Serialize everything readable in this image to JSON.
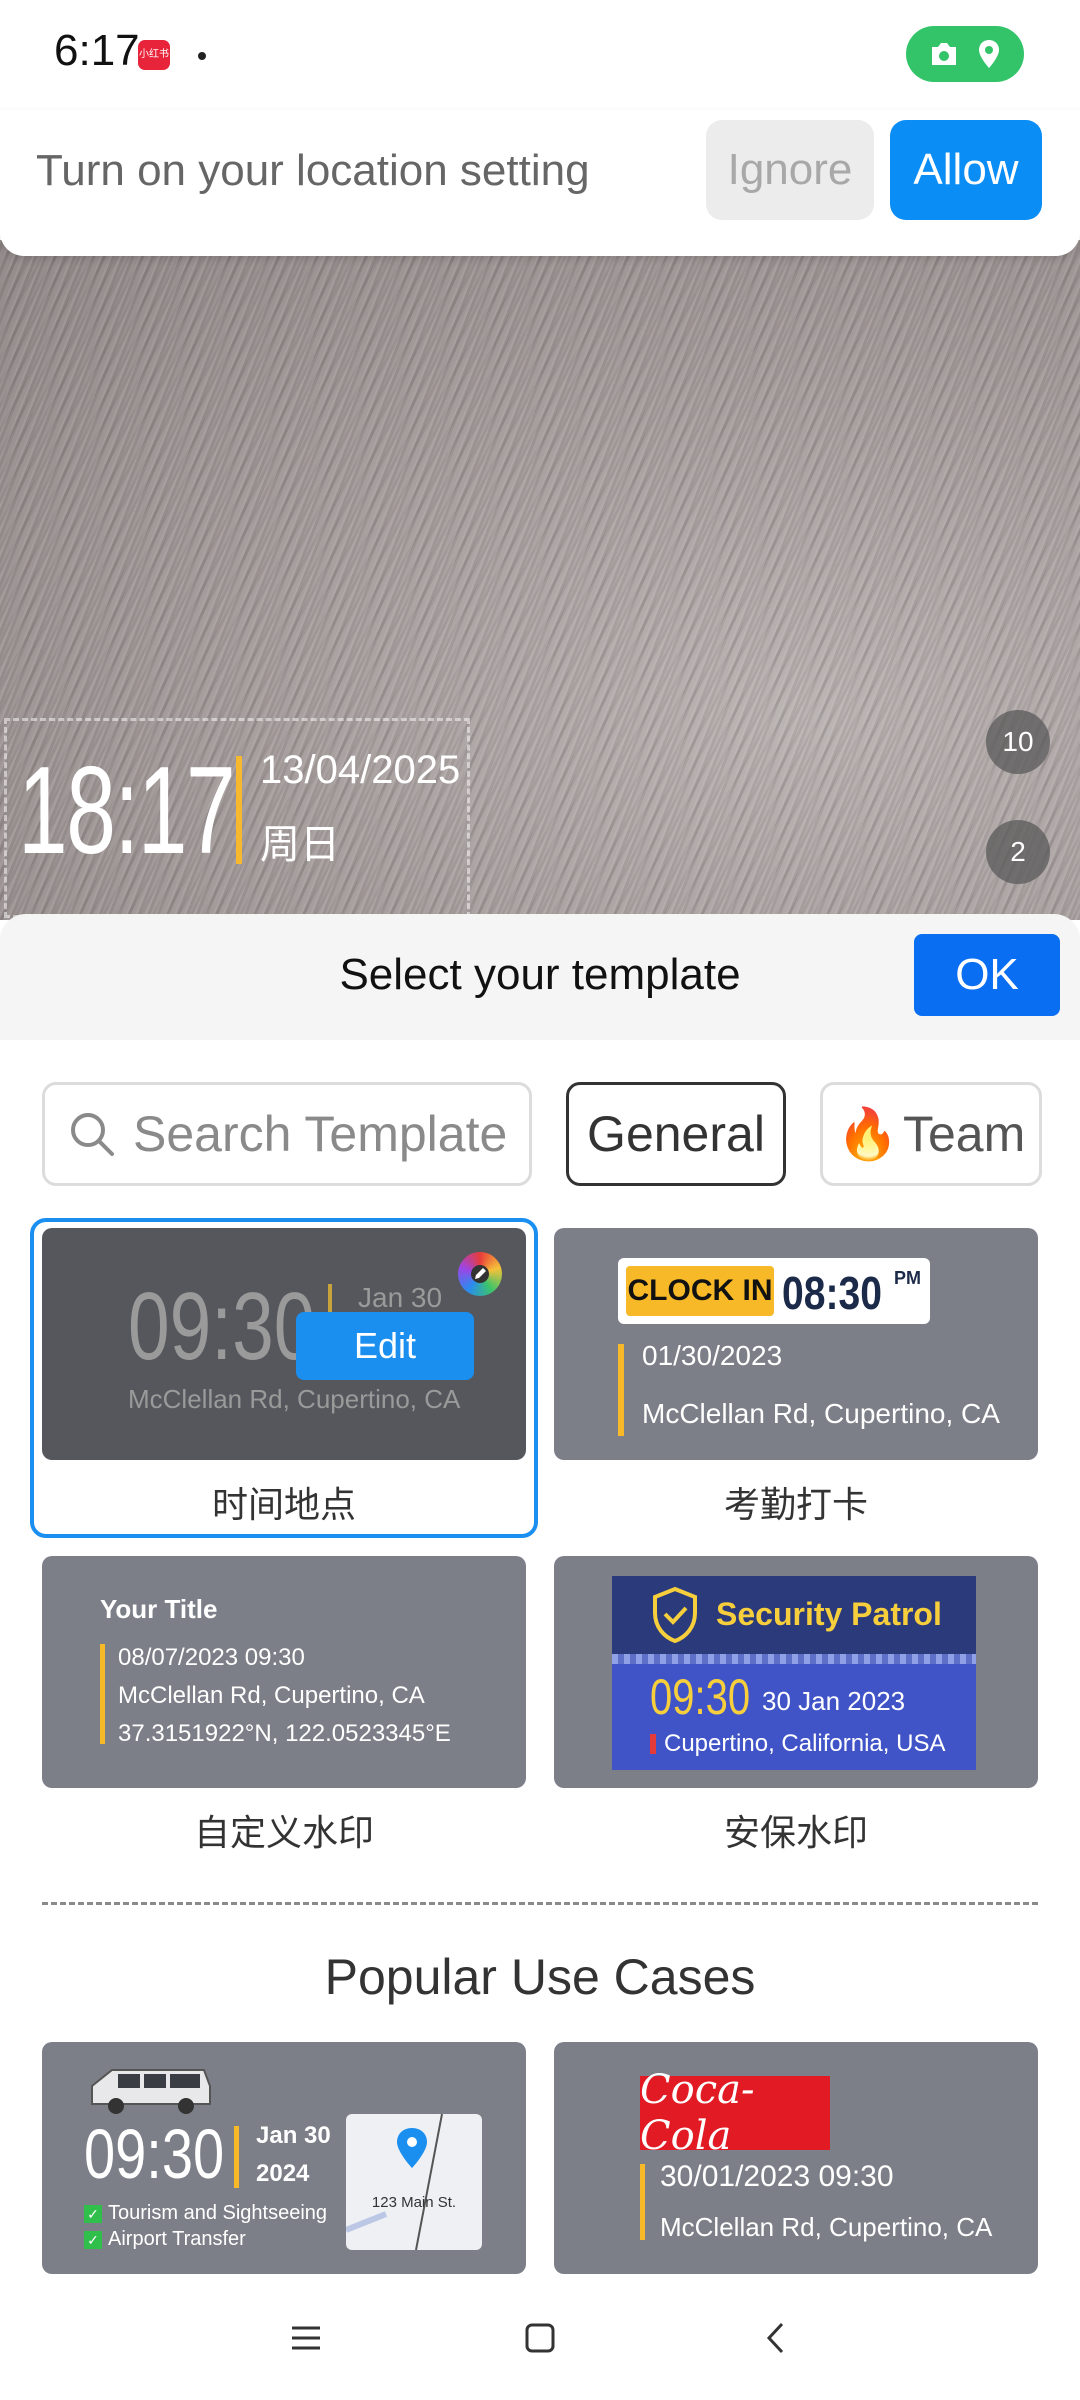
{
  "status_bar": {
    "time": "6:17",
    "app_icon_text": "小红书",
    "icons": [
      "camera-icon",
      "location-icon"
    ],
    "pill_color": "#33c46a"
  },
  "location_banner": {
    "message": "Turn on your location setting",
    "ignore_label": "Ignore",
    "allow_label": "Allow",
    "allow_color": "#0a8df5"
  },
  "camera_preview": {
    "watermark_time": "18:17",
    "watermark_date": "13/04/2025",
    "watermark_day": "周日",
    "badge_top": "10",
    "badge_bottom": "2"
  },
  "sheet": {
    "title": "Select your template",
    "ok_label": "OK",
    "search_placeholder": "Search Template",
    "chip_general": "General",
    "chip_team_emoji": "🔥",
    "chip_team": "Team"
  },
  "templates": [
    {
      "label": "时间地点",
      "selected": true,
      "time": "09:30",
      "date": "Jan 30",
      "address": "McClellan Rd, Cupertino, CA",
      "edit_label": "Edit"
    },
    {
      "label": "考勤打卡",
      "badge": "CLOCK IN",
      "time": "08:30",
      "ampm": "PM",
      "date": "01/30/2023",
      "address": "McClellan Rd, Cupertino, CA"
    },
    {
      "label": "自定义水印",
      "title": "Your Title",
      "datetime": "08/07/2023  09:30",
      "address": "McClellan Rd, Cupertino, CA",
      "coords": "37.3151922°N, 122.0523345°E"
    },
    {
      "label": "安保水印",
      "title": "Security Patrol",
      "time": "09:30",
      "date": "30 Jan 2023",
      "location": "Cupertino, California, USA"
    }
  ],
  "popular": {
    "title": "Popular Use Cases",
    "items": [
      {
        "time": "09:30",
        "date_line1": "Jan 30",
        "date_line2": "2024",
        "checks": [
          "Tourism and Sightseeing",
          "Airport Transfer"
        ],
        "map_street": "123 Main St."
      },
      {
        "brand": "Coca-Cola",
        "datetime": "30/01/2023  09:30",
        "address": "McClellan Rd, Cupertino, CA"
      }
    ]
  },
  "nav": {
    "icons": [
      "menu-icon",
      "home-icon",
      "back-icon"
    ]
  }
}
